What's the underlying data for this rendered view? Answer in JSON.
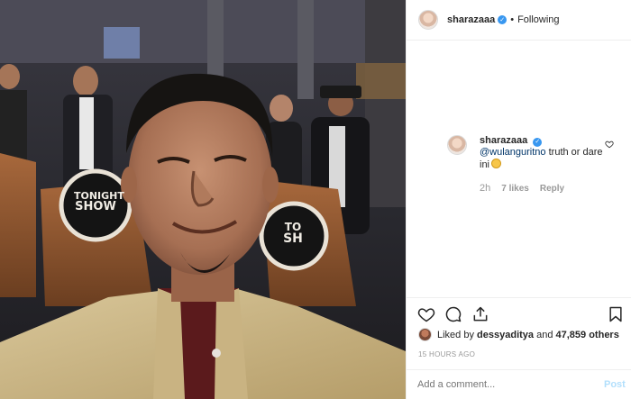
{
  "post": {
    "username": "sharazaaa",
    "separator": "•",
    "follow_status": "Following"
  },
  "photo": {
    "sign_left_line1": "TONIGHT",
    "sign_left_line2": "SHOW",
    "sign_right_line1": "TO",
    "sign_right_line2": "SH"
  },
  "comment": {
    "username": "sharazaaa",
    "mention": "@wulanguritno",
    "text": "truth or dare ini",
    "time": "2h",
    "likes": "7 likes",
    "reply": "Reply"
  },
  "likes": {
    "prefix": "Liked by",
    "user": "dessyaditya",
    "and": "and",
    "others": "47,859 others"
  },
  "timestamp": "15 HOURS AGO",
  "add_comment": {
    "placeholder": "Add a comment...",
    "post_label": "Post"
  },
  "icons": [
    "verified-badge-icon",
    "heart-icon",
    "comment-icon",
    "share-icon",
    "bookmark-icon"
  ],
  "colors": {
    "link": "#003569",
    "badge": "#3897f0",
    "muted": "#999999",
    "post_disabled": "#b2dffc"
  }
}
